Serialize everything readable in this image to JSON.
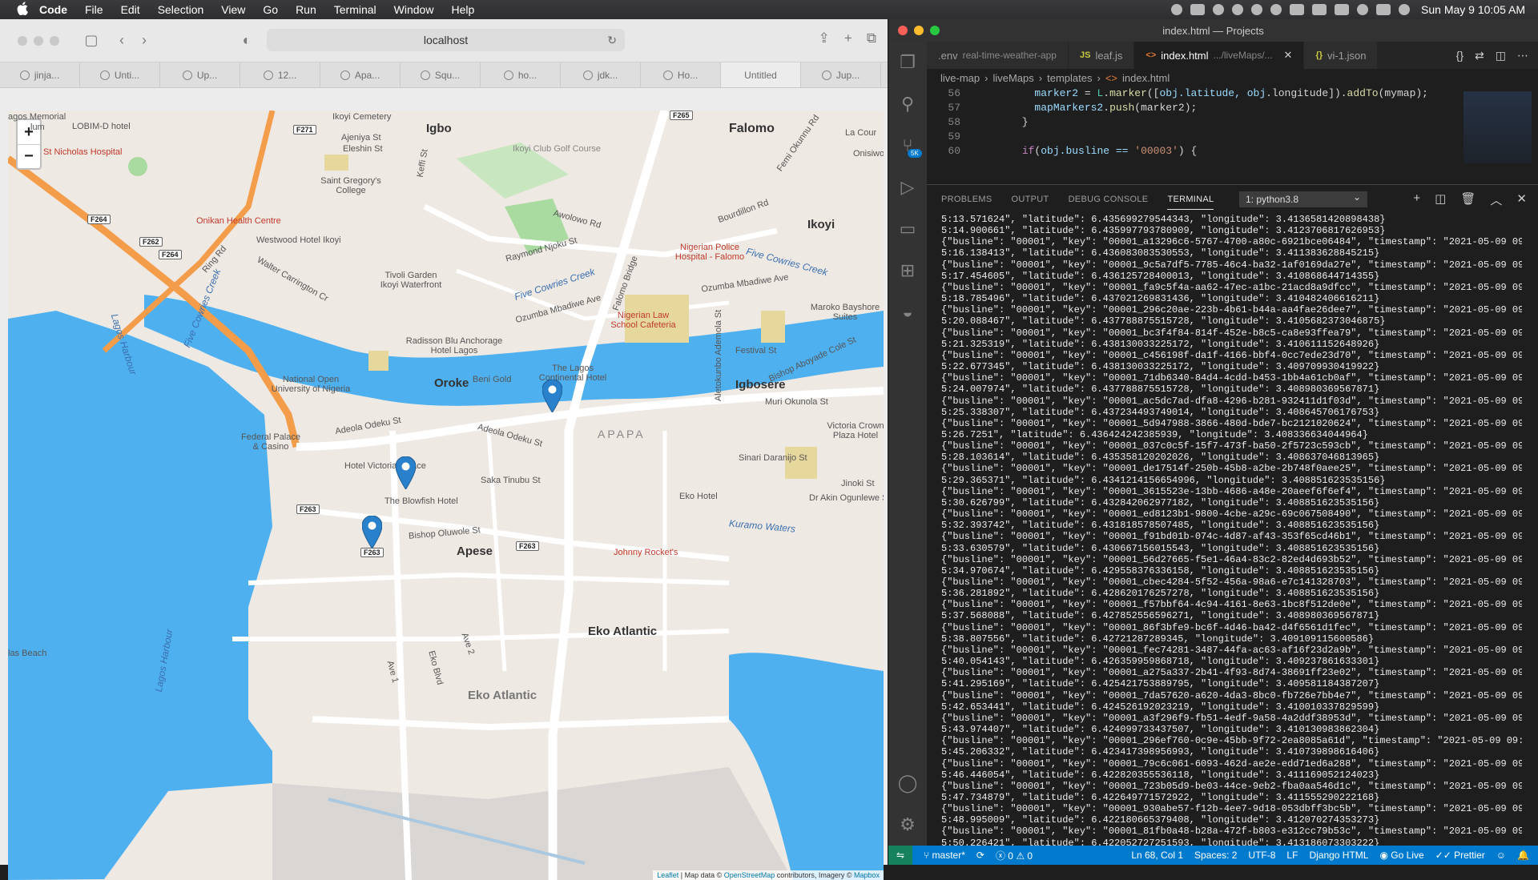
{
  "menubar": {
    "items": [
      "Code",
      "File",
      "Edit",
      "Selection",
      "View",
      "Go",
      "Run",
      "Terminal",
      "Window",
      "Help"
    ],
    "clock": "Sun May 9  10:05 AM"
  },
  "browser": {
    "url": "localhost",
    "tabs": [
      "jinja...",
      "Unti...",
      "Up...",
      "12...",
      "Apa...",
      "Squ...",
      "ho...",
      "jdk...",
      "Ho...",
      "Untitled",
      "Jup..."
    ],
    "active_tab": 9
  },
  "map": {
    "zoom_in": "+",
    "zoom_out": "−",
    "attribution_prefix": "Leaflet",
    "attribution_mid": " | Map data © ",
    "attribution_link": "OpenStreetMap",
    "attribution_suffix": " contributors, Imagery © ",
    "attribution_link2": "Mapbox",
    "labels": {
      "lagos_memorial": "agos Memorial",
      "lum": "lum",
      "lobim": "LOBIM-D hotel",
      "st_nicholas": "St Nicholas Hospital",
      "ikoyi_cemetery": "Ikoyi Cemetery",
      "igbo": "Igbo",
      "ajeniya": "Ajeniya St",
      "eleshin": "Eleshin St",
      "keffi": "Keffi St",
      "golf": "Ikoyi Club Golf Course",
      "falomo": "Falomo",
      "femi": "Femi Okunnu Rd",
      "lacour": "La Cour",
      "onisiwo": "Onisiwo",
      "saint_gregory": "Saint Gregory's College",
      "awolowo": "Awolowo Rd",
      "bourdillon": "Bourdillon Rd",
      "ikoyi": "Ikoyi",
      "onikan": "Onikan Health Centre",
      "westwood": "Westwood Hotel Ikoyi",
      "ring_rd": "Ring Rd",
      "raymond": "Raymond Njoku St",
      "police_hosp": "Nigerian Police Hospital - Falomo",
      "walter": "Walter Carrington Cr",
      "tivoli": "Tivoli Garden Ikoyi Waterfront",
      "five_cowries": "Five Cowries Creek",
      "five_cowries2": "Five Cowries Creek",
      "five_cowries3": "Five Cowries Creek",
      "lagos_harbour": "Lagos Harbour",
      "lagos_harbour2": "Lagos Harbour",
      "falomo_bridge": "Falomo Bridge",
      "ozumba": "Ozumba Mbadiwe Ave",
      "ozumba2": "Ozumba Mbadiwe Ave",
      "ozumba3": "Ozumba Mbadiwe Ave",
      "maroko": "Maroko Bayshore Suites",
      "law_school": "Nigerian Law School Cafeteria",
      "radisson": "Radisson Blu Anchorage Hotel Lagos",
      "festival": "Festival St",
      "noun": "National Open University of Nigeria",
      "continental": "The Lagos Continental Hotel",
      "beni_gold": "Beni Gold",
      "oroke": "Oroke",
      "aletokunbo": "Aletokunbo Ademola St",
      "bishop_aboyade": "Bishop Aboyade Cole St",
      "igbosere": "Igbosere",
      "muri": "Muri Okunola St",
      "adeola": "Adeola Odeku St",
      "adeola2": "Adeola Odeku St",
      "apapa": "APAPA",
      "victoria_crown": "Victoria Crown Plaza Hotel",
      "federal_palace": "Federal Palace & Casino",
      "hotel_victoria": "Hotel Victoria Palace",
      "sinari": "Sinari Daranijo St",
      "saka": "Saka Tinubu St",
      "blowfish": "The Blowfish Hotel",
      "jinoki": "Jinoki St",
      "akin": "Dr Akin Ogunlewe St",
      "eko_hotel": "Eko Hotel",
      "kuramo": "Kuramo Waters",
      "bishop_oluwole": "Bishop Oluwole St",
      "apese": "Apese",
      "johnny": "Johnny Rocket's",
      "eko_atlantic": "Eko Atlantic",
      "eko_atlantic2": "Eko Atlantic",
      "ave2": "Ave 2",
      "ave1": "Ave 1",
      "eko_blvd": "Eko Blvd",
      "las_beach": "las Beach"
    },
    "road_shields": [
      "F264",
      "F262",
      "F264",
      "F271",
      "F265",
      "F263",
      "F263",
      "F263"
    ]
  },
  "vscode": {
    "title": "index.html — Projects",
    "tabs": [
      {
        "icon": "",
        "label": ".env",
        "sub": "real-time-weather-app"
      },
      {
        "icon": "JS",
        "label": "leaf.js",
        "sub": ""
      },
      {
        "icon": "<>",
        "label": "index.html",
        "sub": ".../liveMaps/...",
        "active": true
      },
      {
        "icon": "{}",
        "label": "vi-1.json",
        "sub": ""
      }
    ],
    "breadcrumb": [
      "live-map",
      "liveMaps",
      "templates",
      "index.html"
    ],
    "code_lines": [
      {
        "n": "56",
        "text": ""
      },
      {
        "n": "57",
        "text": ""
      },
      {
        "n": "58",
        "text": "      }"
      },
      {
        "n": "59",
        "text": ""
      },
      {
        "n": "60",
        "text": ""
      }
    ],
    "code_56": {
      "a": "marker2",
      "b": " = ",
      "c": "L",
      "d": ".",
      "e": "marker",
      "f": "([",
      "g": "obj",
      "h": ".latitude, ",
      "i": "obj",
      "j": ".longitude]).",
      "k": "addTo",
      "l": "(mymap);"
    },
    "code_57": {
      "a": "mapMarkers2",
      "b": ".",
      "c": "push",
      "d": "(marker2);"
    },
    "code_60": {
      "a": "if",
      "b": "(",
      "c": "obj",
      "d": ".busline == ",
      "e": "'00003'",
      "f": ") {"
    },
    "panel_tabs": [
      "PROBLEMS",
      "OUTPUT",
      "DEBUG CONSOLE",
      "TERMINAL"
    ],
    "active_panel_tab": 3,
    "terminal_select": "1: python3.8",
    "terminal_lines": [
      "5:13.571624\", \"latitude\": 6.435699279544343, \"longitude\": 3.4136581420898438}",
      "5:14.900661\", \"latitude\": 6.435997793780909, \"longitude\": 3.4123706817626953}",
      "{\"busline\": \"00001\", \"key\": \"00001_a13296c6-5767-4700-a80c-6921bce06484\", \"timestamp\": \"2021-05-09 09:0",
      "5:16.138413\", \"latitude\": 6.436083083530553, \"longitude\": 3.411383628845215}",
      "{\"busline\": \"00001\", \"key\": \"00001_9c5a7df5-7785-46c4-ba32-1af0169da27e\", \"timestamp\": \"2021-05-09 09:0",
      "5:17.454605\", \"latitude\": 6.436125728400013, \"longitude\": 3.410868644714355}",
      "{\"busline\": \"00001\", \"key\": \"00001_fa9c5f4a-aa62-47ec-a1bc-21acd8a9dfcc\", \"timestamp\": \"2021-05-09 09:0",
      "5:18.785496\", \"latitude\": 6.437021269831436, \"longitude\": 3.410482406616211}",
      "{\"busline\": \"00001\", \"key\": \"00001_296c20ae-223b-4b61-b44a-aa4fae26dee7\", \"timestamp\": \"2021-05-09 09:0",
      "5:20.088467\", \"latitude\": 6.437788875515728, \"longitude\": 3.4105682373046875}",
      "{\"busline\": \"00001\", \"key\": \"00001_bc3f4f84-814f-452e-b8c5-ca8e93ffea79\", \"timestamp\": \"2021-05-09 09:0",
      "5:21.325319\", \"latitude\": 6.438130033225172, \"longitude\": 3.410611152648926}",
      "{\"busline\": \"00001\", \"key\": \"00001_c456198f-da1f-4166-bbf4-0cc7ede23d70\", \"timestamp\": \"2021-05-09 09:0",
      "5:22.677345\", \"latitude\": 6.438130033225172, \"longitude\": 3.409709930419922}",
      "{\"busline\": \"00001\", \"key\": \"00001_71db6340-84d4-4cdd-b453-1bb4a61cb0af\", \"timestamp\": \"2021-05-09 09:0",
      "5:24.007974\", \"latitude\": 6.437788875515728, \"longitude\": 3.408980369567871}",
      "{\"busline\": \"00001\", \"key\": \"00001_ac5dc7ad-dfa8-4296-b281-932411d1f03d\", \"timestamp\": \"2021-05-09 09:0",
      "5:25.338307\", \"latitude\": 6.437234493749014, \"longitude\": 3.408645706176753}",
      "{\"busline\": \"00001\", \"key\": \"00001_5d947988-3866-480d-bde7-bc2121020624\", \"timestamp\": \"2021-05-09 09:0",
      "5:26.7251\", \"latitude\": 6.436424242385939, \"longitude\": 3.408336634044964}",
      "{\"busline\": \"00001\", \"key\": \"00001_037c0c5f-15f7-473f-ba50-2f5723c593cb\", \"timestamp\": \"2021-05-09 09:0",
      "5:28.103614\", \"latitude\": 6.435358120202026, \"longitude\": 3.408637046813965}",
      "{\"busline\": \"00001\", \"key\": \"00001_de17514f-250b-45b8-a2be-2b748f0aee25\", \"timestamp\": \"2021-05-09 09:0",
      "5:29.365371\", \"latitude\": 6.4341214156654996, \"longitude\": 3.408851623535156}",
      "{\"busline\": \"00001\", \"key\": \"00001_3615523e-13bb-4686-a48e-20aeef6f6ef4\", \"timestamp\": \"2021-05-09 09:0",
      "5:30.626799\", \"latitude\": 6.432842062977182, \"longitude\": 3.408851623535156}",
      "{\"busline\": \"00001\", \"key\": \"00001_ed8123b1-9800-4cbe-a29c-69c067508490\", \"timestamp\": \"2021-05-09 09:0",
      "5:32.393742\", \"latitude\": 6.431818578507485, \"longitude\": 3.408851623535156}",
      "{\"busline\": \"00001\", \"key\": \"00001_f91bd01b-074c-4d87-af43-353f65cd46b1\", \"timestamp\": \"2021-05-09 09:0",
      "5:33.630579\", \"latitude\": 6.430667156015543, \"longitude\": 3.408851623535156}",
      "{\"busline\": \"00001\", \"key\": \"00001_56d27665-f5e1-46a4-83c2-82ed4d693b52\", \"timestamp\": \"2021-05-09 09:0",
      "5:34.970674\", \"latitude\": 6.429558376336158, \"longitude\": 3.408851623535156}",
      "{\"busline\": \"00001\", \"key\": \"00001_cbec4284-5f52-456a-98a6-e7c141328703\", \"timestamp\": \"2021-05-09 09:0",
      "5:36.281892\", \"latitude\": 6.428620176257278, \"longitude\": 3.408851623535156}",
      "{\"busline\": \"00001\", \"key\": \"00001_f57bbf64-4c94-4161-8e63-1bc8f512de0e\", \"timestamp\": \"2021-05-09 09:0",
      "5:37.568088\", \"latitude\": 6.427852556596271, \"longitude\": 3.408980369567871}",
      "{\"busline\": \"00001\", \"key\": \"00001_86f3bfe9-bc6f-4d46-ba42-d4f6561d1fec\", \"timestamp\": \"2021-05-09 09:0",
      "5:38.807556\", \"latitude\": 6.42721287289345, \"longitude\": 3.409109115600586}",
      "{\"busline\": \"00001\", \"key\": \"00001_fec74281-3487-44fa-ac63-af16f23d2a9b\", \"timestamp\": \"2021-05-09 09:0",
      "5:40.054143\", \"latitude\": 6.426359959868718, \"longitude\": 3.409237861633301}",
      "{\"busline\": \"00001\", \"key\": \"00001_a275a337-2b41-4f93-8d74-38691ff23e02\", \"timestamp\": \"2021-05-09 09:0",
      "5:41.295169\", \"latitude\": 6.425421753889795, \"longitude\": 3.409581184387207}",
      "{\"busline\": \"00001\", \"key\": \"00001_7da57620-a620-4da3-8bc0-fb726e7bb4e7\", \"timestamp\": \"2021-05-09 09:0",
      "5:42.653441\", \"latitude\": 6.424526192023219, \"longitude\": 3.410010337829599}",
      "{\"busline\": \"00001\", \"key\": \"00001_a3f296f9-fb51-4edf-9a58-4a2ddf38953d\", \"timestamp\": \"2021-05-09 09:0",
      "5:43.974407\", \"latitude\": 6.424099733437507, \"longitude\": 3.410130983862304}",
      "{\"busline\": \"00001\", \"key\": \"00001_296ef760-0c9e-45bb-9f72-2ea8085a61d\", \"timestamp\": \"2021-05-09 09:0",
      "5:45.206332\", \"latitude\": 6.423417398956993, \"longitude\": 3.410739898616406}",
      "{\"busline\": \"00001\", \"key\": \"00001_79c6c061-6093-462d-ae2e-edd71ed6a288\", \"timestamp\": \"2021-05-09 09:0",
      "5:46.446054\", \"latitude\": 6.422820355536118, \"longitude\": 3.411169052124023}",
      "{\"busline\": \"00001\", \"key\": \"00001_723b05d9-be03-44ce-9eb2-fba0aa546d1c\", \"timestamp\": \"2021-05-09 09:0",
      "5:47.734879\", \"latitude\": 6.422649771572922, \"longitude\": 3.411555290222168}",
      "{\"busline\": \"00001\", \"key\": \"00001_930abe57-f12b-4ee7-9d18-053dbff3bc5b\", \"timestamp\": \"2021-05-09 09:0",
      "5:48.995009\", \"latitude\": 6.422180665379408, \"longitude\": 3.412070274353273}",
      "{\"busline\": \"00001\", \"key\": \"00001_81fb0a48-b28a-472f-b803-e312cc79b53c\", \"timestamp\": \"2021-05-09 09:0",
      "5:50.226421\", \"latitude\": 6.422052727251593, \"longitude\": 3.413186073303222}"
    ],
    "status": {
      "branch": "master*",
      "errors": "0",
      "warnings": "0",
      "position": "Ln 68, Col 1",
      "spaces": "Spaces: 2",
      "encoding": "UTF-8",
      "eol": "LF",
      "language": "Django HTML",
      "golive": "Go Live",
      "prettier": "Prettier"
    }
  }
}
